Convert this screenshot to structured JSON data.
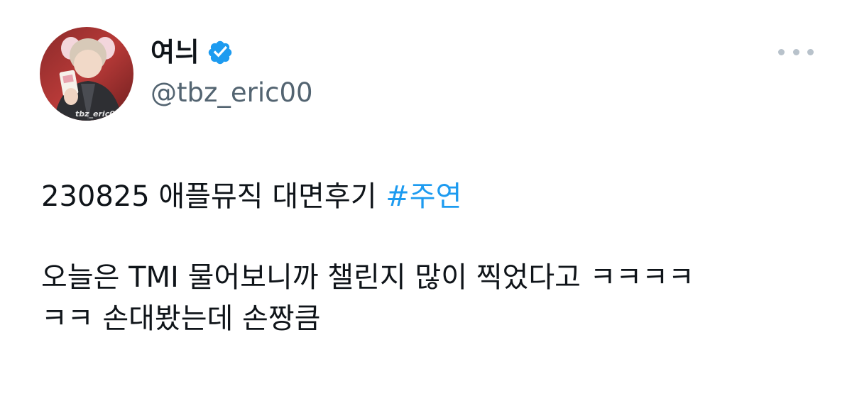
{
  "user": {
    "display_name": "여늬",
    "handle": "@tbz_eric00",
    "verified": true,
    "avatar_watermark": "tbz_eric00"
  },
  "more_menu": {
    "icon": "more-horizontal-icon"
  },
  "tweet": {
    "line1_text": "230825 애플뮤직 대면후기 ",
    "hashtag": "#주연",
    "para2_line1": "오늘은 TMI 물어보니까 챌린지 많이 찍었다고 ㅋㅋㅋㅋ",
    "para2_line2": "ㅋㅋ 손대봤는데 손짱큼"
  },
  "colors": {
    "text": "#0f1419",
    "secondary": "#536471",
    "accent": "#1d9bf0",
    "verified_badge": "#1d9bf0"
  }
}
